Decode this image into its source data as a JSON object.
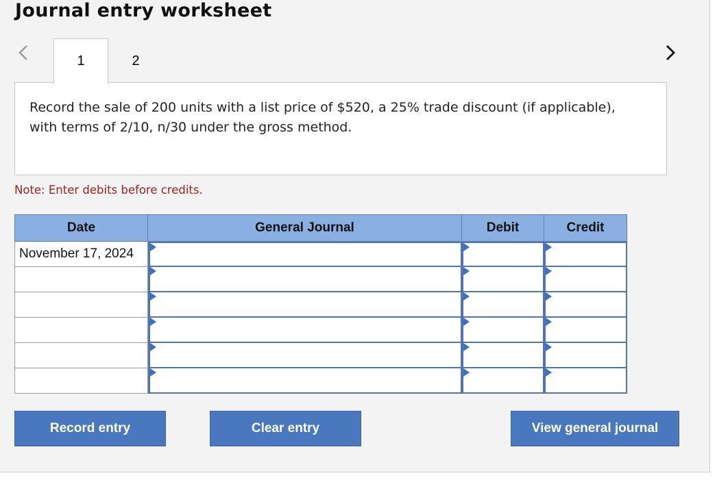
{
  "worksheet": {
    "title": "Journal entry worksheet",
    "tabs": [
      {
        "label": "1",
        "active": true
      },
      {
        "label": "2",
        "active": false
      }
    ],
    "prev_icon": "chevron-left-icon",
    "next_icon": "chevron-right-icon"
  },
  "question": {
    "text": "Record the sale of 200 units with a list price of $520, a 25% trade discount (if applicable), with terms of 2/10, n/30 under the gross method."
  },
  "note": "Note: Enter debits before credits.",
  "journal": {
    "headers": {
      "date": "Date",
      "account": "General Journal",
      "debit": "Debit",
      "credit": "Credit"
    },
    "rows": [
      {
        "date": "November 17, 2024",
        "account": "",
        "debit": "",
        "credit": ""
      },
      {
        "date": "",
        "account": "",
        "debit": "",
        "credit": ""
      },
      {
        "date": "",
        "account": "",
        "debit": "",
        "credit": ""
      },
      {
        "date": "",
        "account": "",
        "debit": "",
        "credit": ""
      },
      {
        "date": "",
        "account": "",
        "debit": "",
        "credit": ""
      },
      {
        "date": "",
        "account": "",
        "debit": "",
        "credit": ""
      }
    ]
  },
  "buttons": {
    "record": "Record entry",
    "clear": "Clear entry",
    "view": "View general journal"
  },
  "colors": {
    "header_bg": "#8ab0e2",
    "cell_border": "#4f74b3",
    "button_bg": "#4a78bf",
    "note_text": "#a02020"
  }
}
